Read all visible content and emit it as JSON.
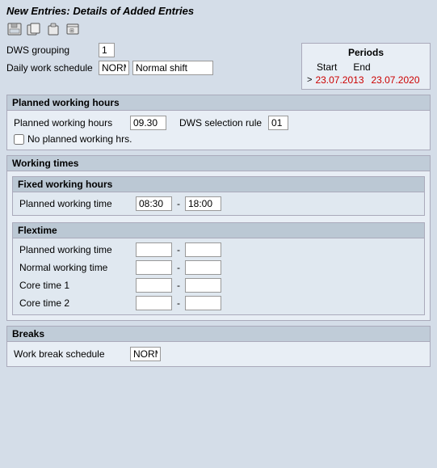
{
  "title": "New Entries: Details of Added Entries",
  "toolbar": {
    "icons": [
      {
        "name": "save-icon",
        "glyph": "💾"
      },
      {
        "name": "copy-icon",
        "glyph": "📋"
      },
      {
        "name": "paste-icon",
        "glyph": "🗂"
      },
      {
        "name": "config-icon",
        "glyph": "🔧"
      }
    ]
  },
  "dws_grouping": {
    "label": "DWS grouping",
    "value": "1"
  },
  "daily_work_schedule": {
    "label": "Daily work schedule",
    "code_value": "NORM",
    "name_value": "Normal shift"
  },
  "periods": {
    "title": "Periods",
    "start_label": "Start",
    "end_label": "End",
    "arrow": ">",
    "start_date": "23.07.2013",
    "end_date": "23.07.2020"
  },
  "planned_working_hours": {
    "section_title": "Planned working hours",
    "label": "Planned working hours",
    "value": "09.30",
    "dws_selection_label": "DWS selection rule",
    "dws_selection_value": "01",
    "no_planned_label": "No planned working hrs."
  },
  "working_times": {
    "section_title": "Working times",
    "fixed": {
      "sub_title": "Fixed working hours",
      "planned_label": "Planned working time",
      "start": "08:30",
      "end": "18:00",
      "dash": "-"
    },
    "flextime": {
      "sub_title": "Flextime",
      "rows": [
        {
          "label": "Planned working time",
          "start": "",
          "end": "",
          "dash": "-"
        },
        {
          "label": "Normal working time",
          "start": "",
          "end": "",
          "dash": "-"
        },
        {
          "label": "Core time 1",
          "start": "",
          "end": "",
          "dash": "-"
        },
        {
          "label": "Core time 2",
          "start": "",
          "end": "",
          "dash": "-"
        }
      ]
    }
  },
  "breaks": {
    "section_title": "Breaks",
    "label": "Work break schedule",
    "value": "NORM"
  }
}
